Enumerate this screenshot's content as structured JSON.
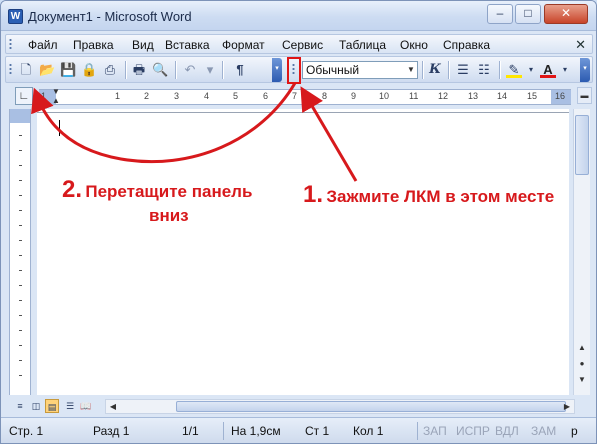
{
  "window": {
    "title": "Документ1 - Microsoft Word",
    "app_icon_letter": "W",
    "min_glyph": "–",
    "max_glyph": "□",
    "close_glyph": "✕"
  },
  "menubar": {
    "items": [
      "Файл",
      "Правка",
      "Вид",
      "Вставка",
      "Формат",
      "Сервис",
      "Таблица",
      "Окно",
      "Справка"
    ],
    "close_glyph": "✕"
  },
  "toolbar": {
    "style_value": "Обычный",
    "dropdown_glyph": "▼",
    "icons": [
      "new-document",
      "open",
      "save",
      "permission",
      "print-preview",
      "print",
      "spell-check",
      "undo",
      "redo",
      "show-formatting",
      "italic",
      "numbering",
      "bullets",
      "highlight",
      "font-color"
    ],
    "paragraph_glyph": "¶",
    "italic_glyph": "К",
    "font_color_glyph": "A"
  },
  "ruler": {
    "tab_selector_glyph": "∟",
    "numbers": [
      "1",
      "1",
      "2",
      "3",
      "4",
      "5",
      "6",
      "7",
      "8",
      "9",
      "10",
      "11",
      "12",
      "13",
      "14",
      "15",
      "16"
    ]
  },
  "status": {
    "page": "Стр. 1",
    "section": "Разд 1",
    "page_of": "1/1",
    "position": "На 1,9см",
    "line": "Ст 1",
    "column": "Кол 1",
    "rec": "ЗАП",
    "trk": "ИСПР",
    "ext": "ВДЛ",
    "ovr": "ЗАМ",
    "lang": "р"
  },
  "annotations": {
    "step1_number": "1.",
    "step1_text": "Зажмите ЛКМ в этом месте",
    "step2_number": "2.",
    "step2_line1": "Перетащите панель",
    "step2_line2": "вниз",
    "color": "#d7191c"
  }
}
